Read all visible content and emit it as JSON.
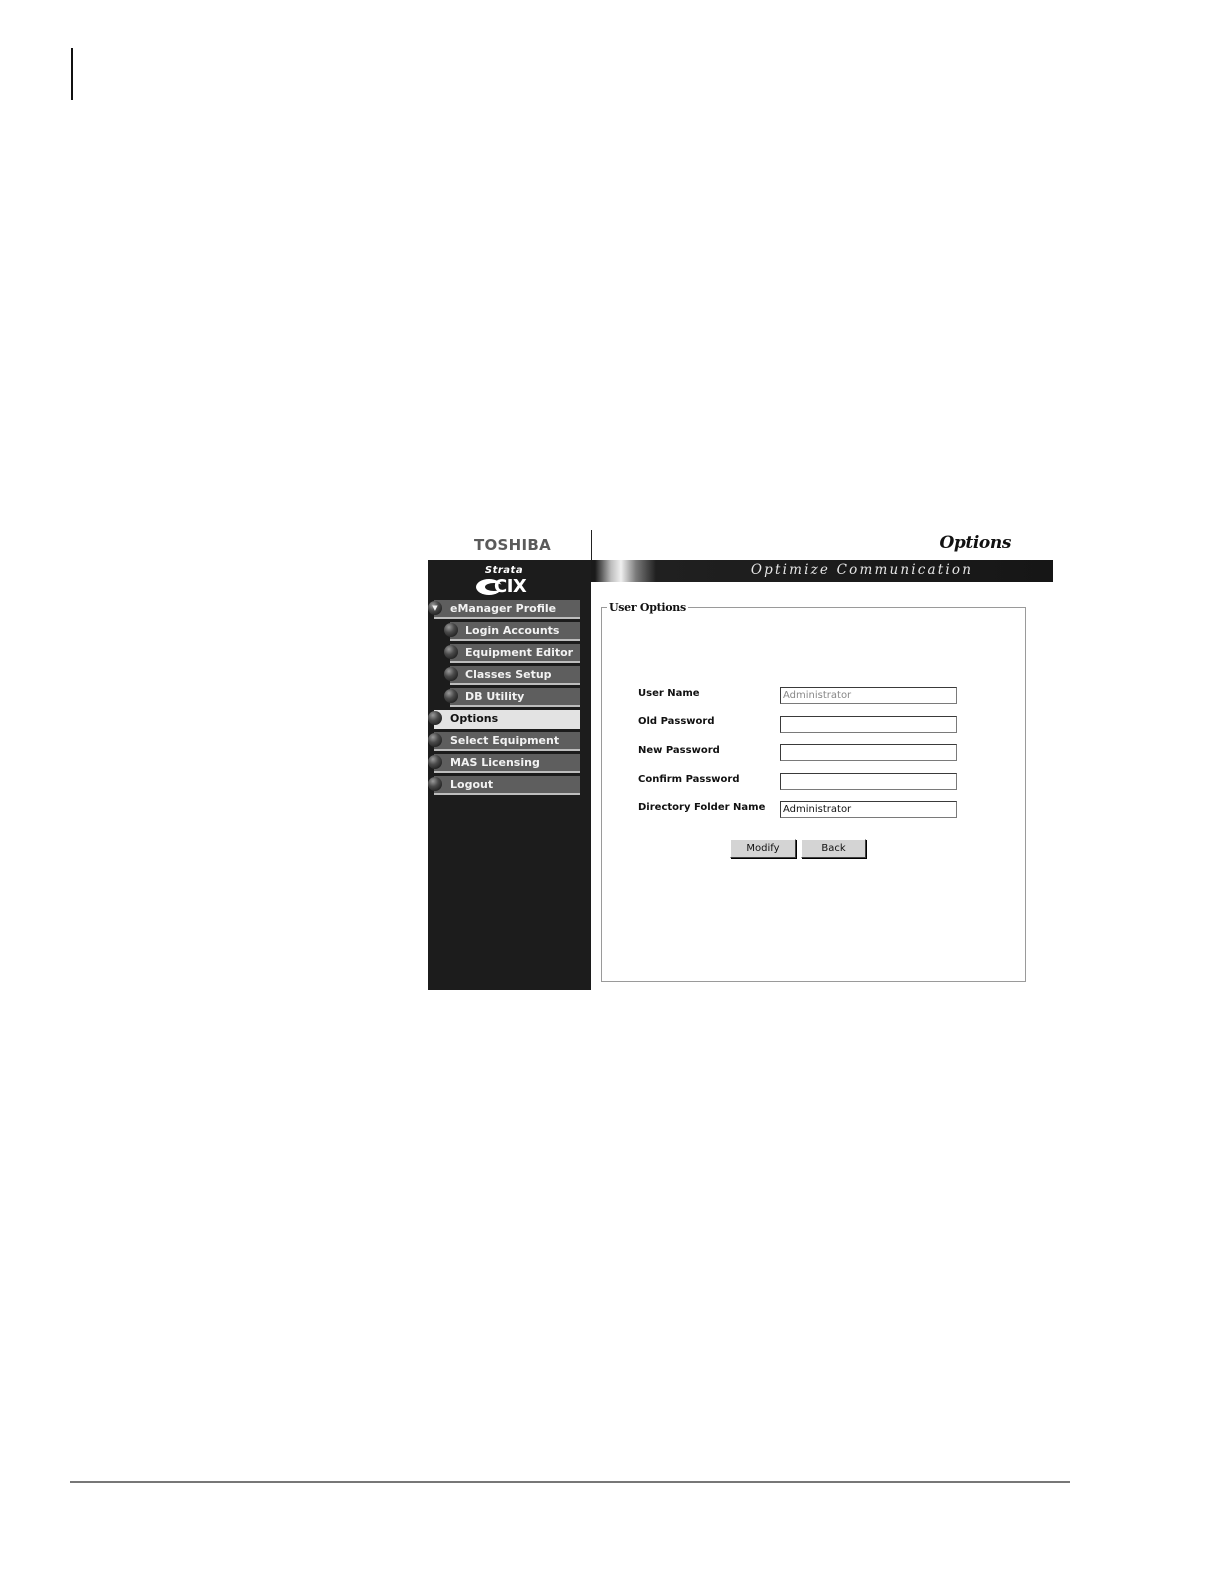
{
  "header": {
    "brand": "TOSHIBA",
    "page_title": "Options",
    "banner": "Optimize Communication"
  },
  "logo": {
    "strata": "Strata",
    "cix": "CIX"
  },
  "sidebar": {
    "items": [
      {
        "label": "eManager Profile",
        "level": "top",
        "expanded": true
      },
      {
        "label": "Login Accounts",
        "level": "sub"
      },
      {
        "label": "Equipment Editor",
        "level": "sub"
      },
      {
        "label": "Classes Setup",
        "level": "sub"
      },
      {
        "label": "DB Utility",
        "level": "sub"
      },
      {
        "label": "Options",
        "level": "top",
        "active": true
      },
      {
        "label": "Select Equipment",
        "level": "top"
      },
      {
        "label": "MAS Licensing",
        "level": "top"
      },
      {
        "label": "Logout",
        "level": "top"
      }
    ]
  },
  "form": {
    "legend": "User Options",
    "fields": [
      {
        "label": "User Name",
        "value": "Administrator",
        "disabled": true
      },
      {
        "label": "Old Password",
        "value": ""
      },
      {
        "label": "New Password",
        "value": ""
      },
      {
        "label": "Confirm Password",
        "value": ""
      },
      {
        "label": "Directory Folder Name",
        "value": "Administrator"
      }
    ],
    "buttons": {
      "modify": "Modify",
      "back": "Back"
    }
  },
  "icons": {
    "expand": "triangle-down-icon",
    "menu_bullet": "sphere-bullet-icon"
  },
  "colors": {
    "sidebar_bg": "#1c1c1c",
    "menu_item_bg": "#5e5e5e",
    "menu_active_bg": "#e3e3e3",
    "button_bg": "#d4d4d4"
  }
}
